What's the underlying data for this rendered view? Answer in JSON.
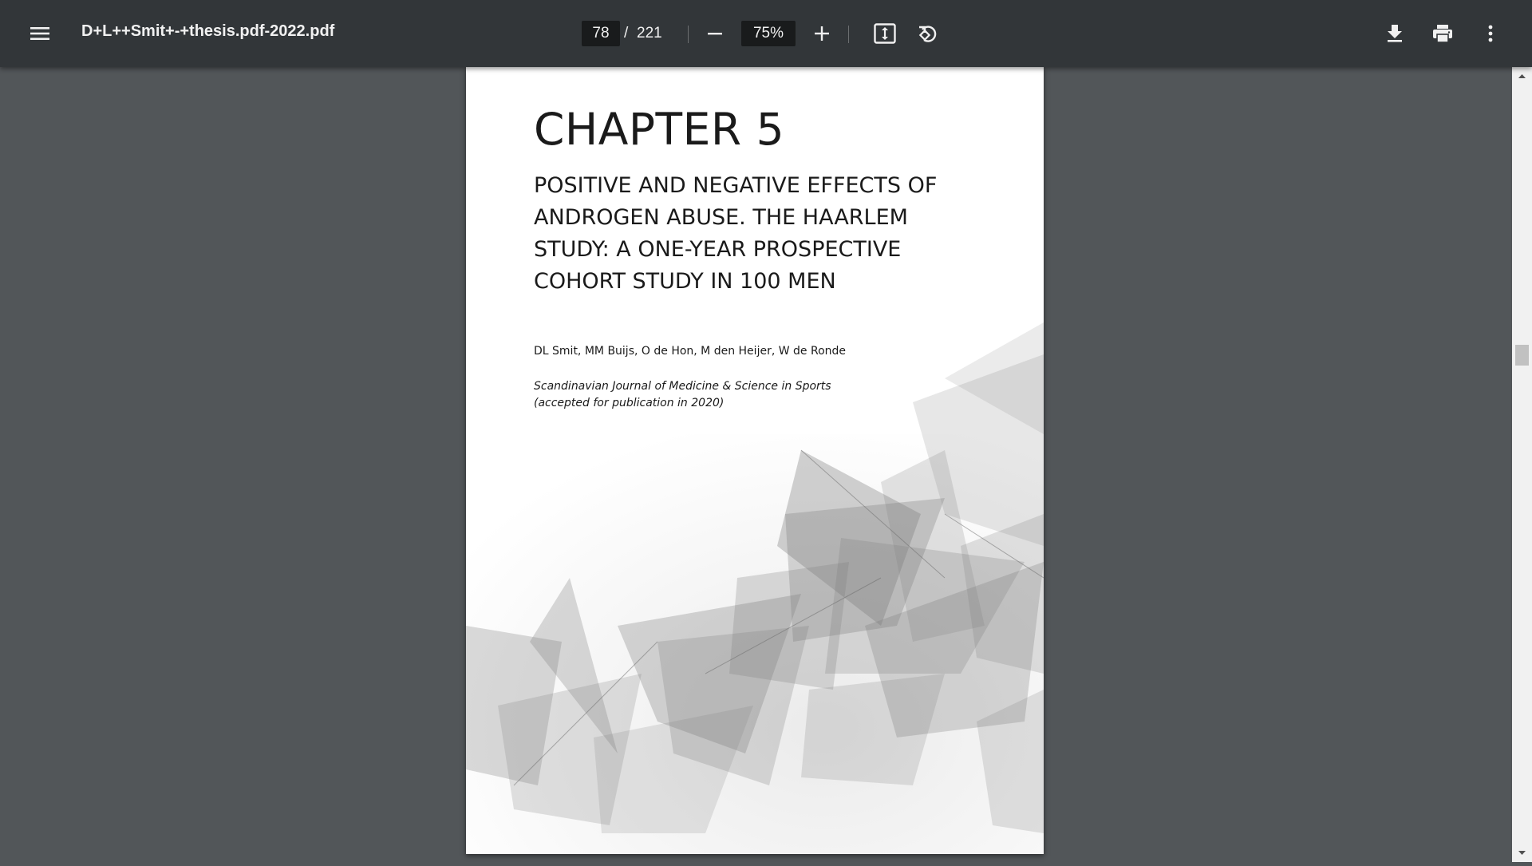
{
  "toolbar": {
    "title": "D+L++Smit+-+thesis.pdf-2022.pdf",
    "page_current": "78",
    "page_separator": "/",
    "page_total": "221",
    "zoom": "75%",
    "icons": {
      "menu": "hamburger-menu-icon",
      "zoom_out": "minus-icon",
      "zoom_in": "plus-icon",
      "fit": "fit-to-page-icon",
      "rotate": "rotate-counterclockwise-icon",
      "download": "download-icon",
      "print": "print-icon",
      "more": "more-vertical-icon"
    }
  },
  "document_page": {
    "chapter": "CHAPTER 5",
    "title": "POSITIVE AND NEGATIVE EFFECTS OF ANDROGEN ABUSE. THE HAARLEM STUDY: A ONE-YEAR PROSPECTIVE COHORT STUDY IN 100 MEN",
    "authors": "DL Smit, MM Buijs, O de Hon, M den Heijer, W de Ronde",
    "journal": "Scandinavian Journal of Medicine & Science in Sports",
    "publication_note": "(accepted for publication in 2020)"
  },
  "colors": {
    "toolbar_bg": "#323639",
    "viewer_bg": "#525659",
    "page_bg": "#ffffff",
    "input_bg": "#191b1c",
    "toolbar_text": "#f1f1f1"
  }
}
